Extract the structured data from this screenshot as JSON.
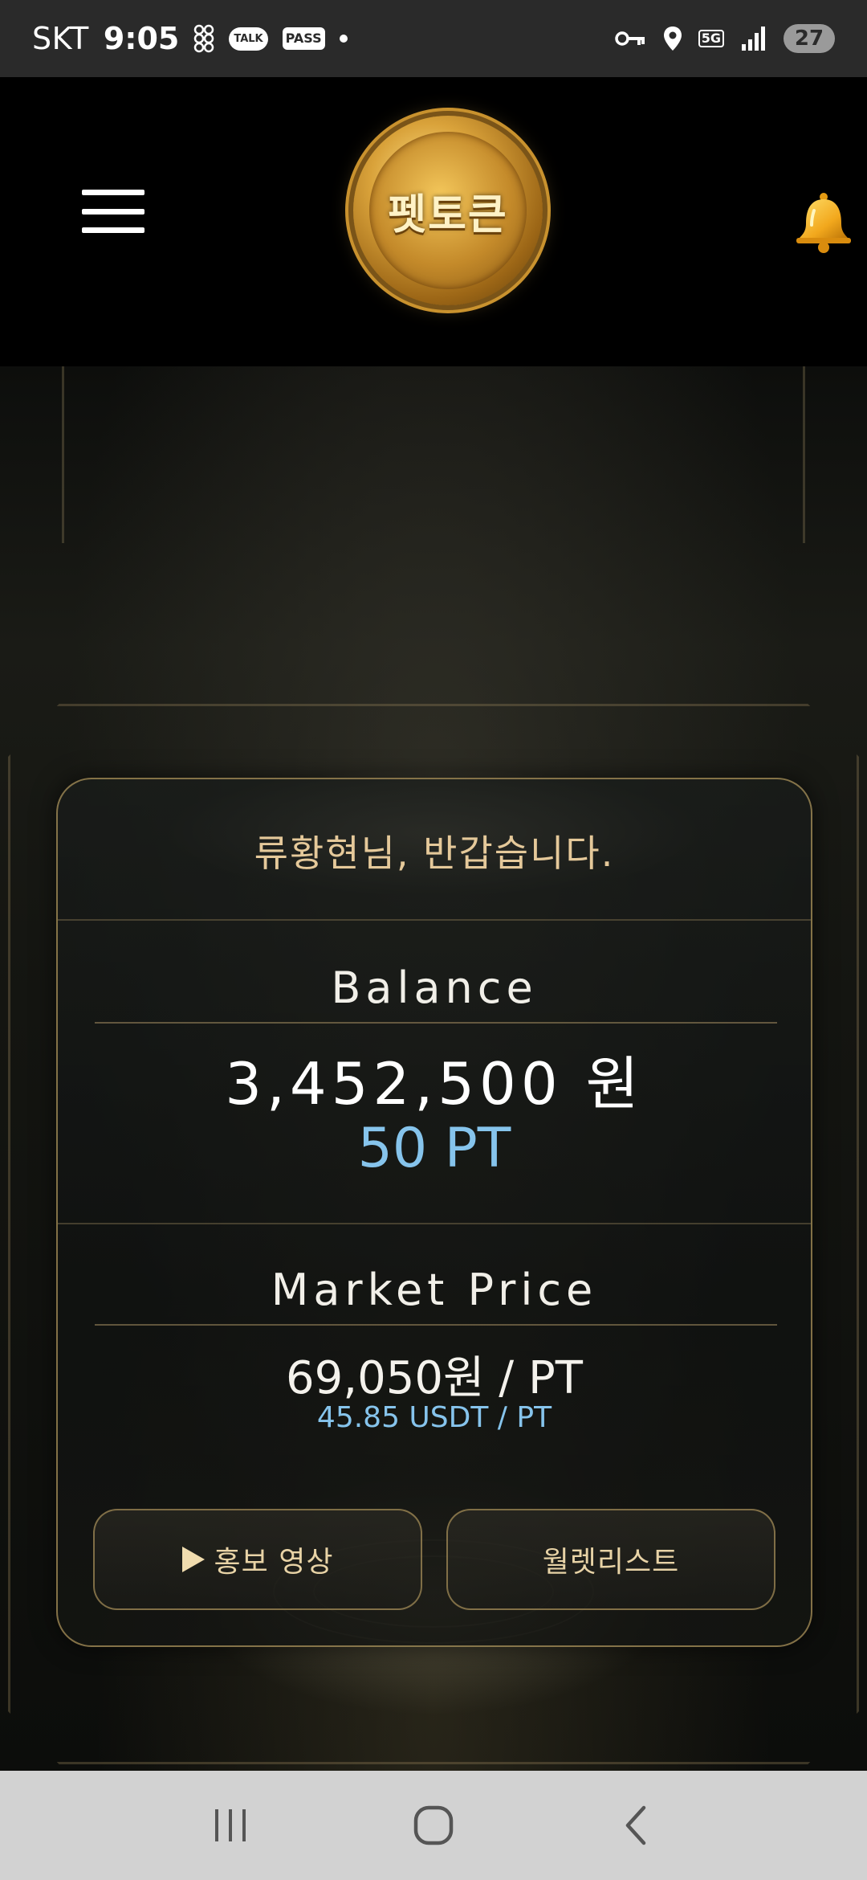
{
  "status_bar": {
    "carrier": "SKT",
    "time": "9:05",
    "talk_label": "TALK",
    "pass_label": "PASS",
    "network": "5G",
    "battery": "27"
  },
  "header": {
    "logo_text": "펫토큰",
    "menu_icon": "hamburger-icon",
    "bell_icon": "bell-icon"
  },
  "card": {
    "greeting": "류황현님, 반갑습니다.",
    "balance": {
      "title": "Balance",
      "won": "3,452,500 원",
      "pt": "50 PT"
    },
    "market": {
      "title": "Market Price",
      "krw": "69,050원 / PT",
      "usdt": "45.85 USDT / PT"
    },
    "buttons": {
      "promo_video": "홍보 영상",
      "whitelist": "월렛리스트"
    }
  },
  "colors": {
    "accent_gold": "#e5c99a",
    "accent_blue": "#86c4ec",
    "statusbar_bg": "#2a2a2a",
    "navbar_bg": "#d2d2d2"
  }
}
